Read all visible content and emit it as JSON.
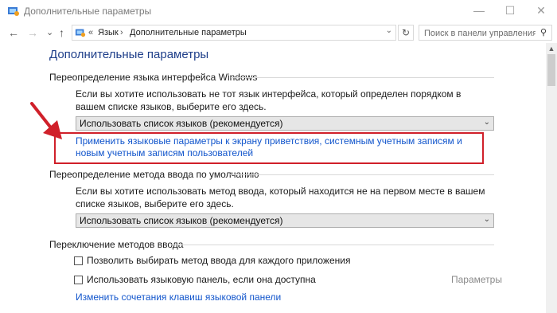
{
  "window": {
    "title": "Дополнительные параметры",
    "minimize": "—",
    "maximize": "☐",
    "close": "✕"
  },
  "nav": {
    "back": "←",
    "forward": "→",
    "recent": "⌄",
    "up": "↑",
    "breadcrumb_chevron": "«",
    "crumbs": [
      "Язык",
      "Дополнительные параметры"
    ],
    "crumb_separator": "›",
    "address_dropdown": "⌄",
    "refresh": "↻",
    "search_placeholder": "Поиск в панели управления",
    "search_icon": "⚲"
  },
  "page": {
    "heading": "Дополнительные параметры",
    "section1": {
      "title": "Переопределение языка интерфейса Windows",
      "description": "Если вы хотите использовать не тот язык интерфейса, который определен порядком в вашем списке языков, выберите его здесь.",
      "dropdown_value": "Использовать список языков (рекомендуется)",
      "link": "Применить языковые параметры к экрану приветствия, системным учетным записям и новым учетным записям пользователей"
    },
    "section2": {
      "title": "Переопределение метода ввода по умолчанию",
      "description": "Если вы хотите использовать метод ввода, который находится не на первом месте в вашем списке языков, выберите его здесь.",
      "dropdown_value": "Использовать список языков (рекомендуется)"
    },
    "section3": {
      "title": "Переключение методов ввода",
      "checkbox1": "Позволить выбирать метод ввода для каждого приложения",
      "checkbox2": "Использовать языковую панель, если она доступна",
      "options_link": "Параметры",
      "link": "Изменить сочетания клавиш языковой панели"
    }
  },
  "colors": {
    "heading": "#1f3f8a",
    "link": "#1155cc",
    "highlight": "#d0202a"
  }
}
